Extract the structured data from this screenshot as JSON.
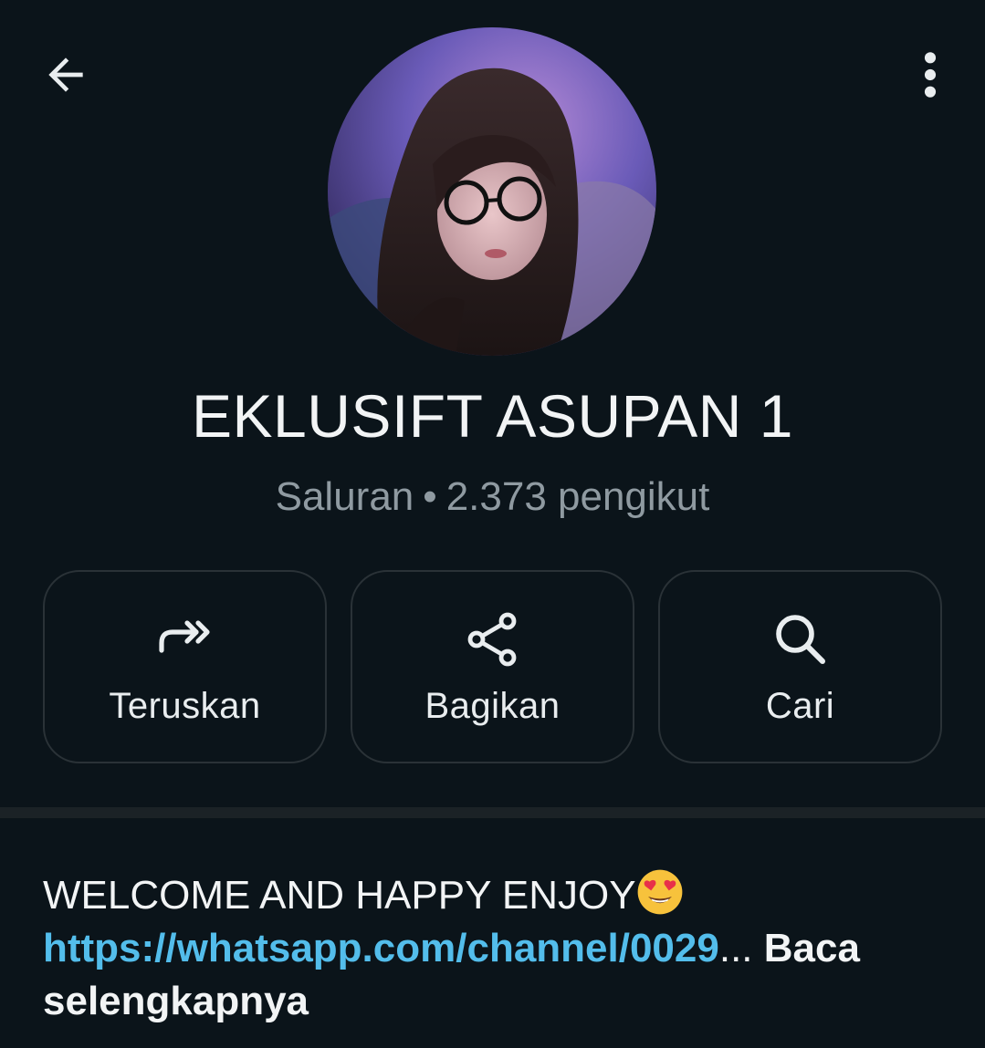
{
  "header": {
    "back_icon": "arrow-left-icon",
    "menu_icon": "more-vertical-icon"
  },
  "channel": {
    "name": "EKLUSIFT ASUPAN 1",
    "type": "Saluran",
    "separator": "•",
    "followers": "2.373 pengikut"
  },
  "actions": [
    {
      "label": "Teruskan",
      "icon": "forward-icon"
    },
    {
      "label": "Bagikan",
      "icon": "share-icon"
    },
    {
      "label": "Cari",
      "icon": "search-icon"
    }
  ],
  "description": {
    "text": "WELCOME AND HAPPY ENJOY",
    "emoji": "heart-eyes-emoji",
    "link": "https://whatsapp.com/channel/0029",
    "ellipsis": "...",
    "read_more": "Baca selengkapnya"
  },
  "colors": {
    "background": "#0b141a",
    "link": "#53bdeb",
    "muted": "#8f9aa1"
  }
}
